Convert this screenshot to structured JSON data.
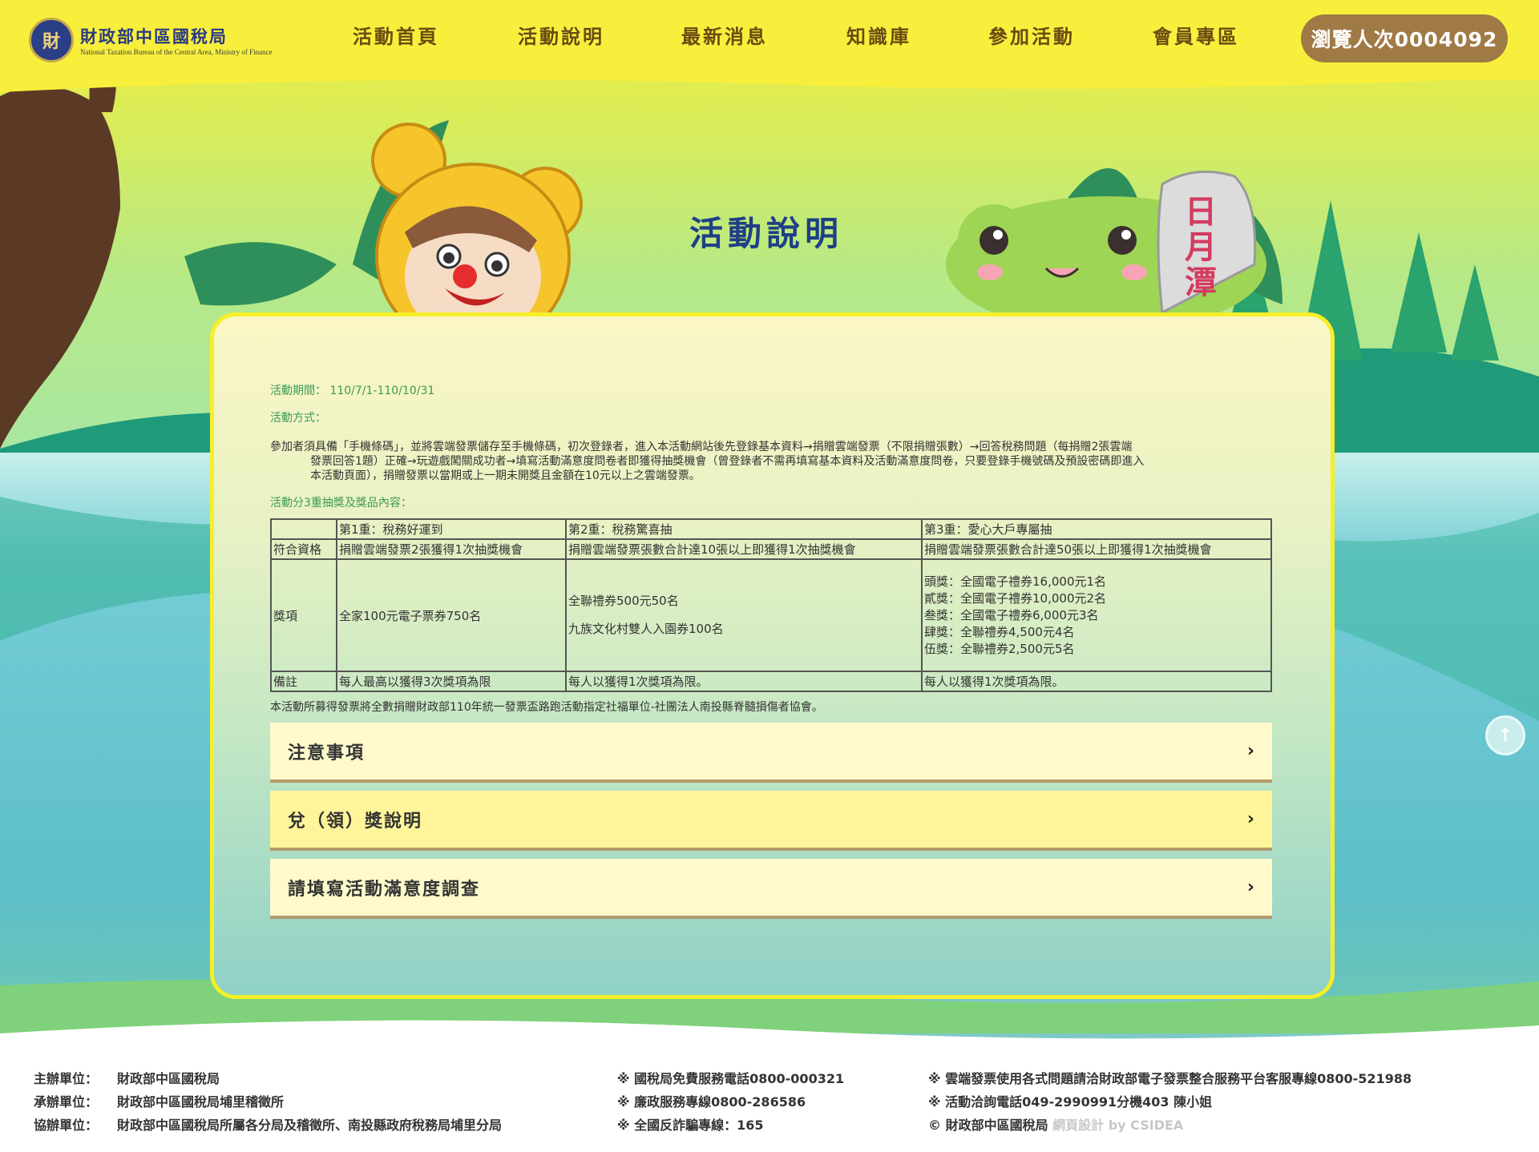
{
  "header": {
    "logo_cn": "財政部中區國稅局",
    "logo_en": "National Taxation Bureau of the Central Area, Ministry of Finance",
    "nav": [
      "活動首頁",
      "活動說明",
      "最新消息",
      "知識庫",
      "參加活動",
      "會員專區"
    ],
    "visitor_count": "瀏覽人次0004092"
  },
  "page_title": "活動說明",
  "scenery": {
    "stone_text": "日月潭"
  },
  "content": {
    "period_label": "活動期間：",
    "period_value": "110/7/1-110/10/31",
    "method_label": "活動方式：",
    "method_line1": "參加者須具備「手機條碼」，並將雲端發票儲存至手機條碼，初次登錄者，進入本活動網站後先登錄基本資料→捐贈雲端發票（不限捐贈張數）→回答稅務問題（每捐贈2張雲端",
    "method_line2": "發票回答1題）正確→玩遊戲闖關成功者→填寫活動滿意度問卷者即獲得抽獎機會（曾登錄者不需再填寫基本資料及活動滿意度問卷，只要登錄手機號碼及預設密碼即進入",
    "method_line3": "本活動頁面），捐贈發票以當期或上一期未開獎且金額在10元以上之雲端發票。",
    "prizes_label": "活動分3重抽獎及獎品內容：",
    "table": {
      "headers": [
        "",
        "第1重：稅務好運到",
        "第2重：稅務驚喜抽",
        "第3重：愛心大戶專屬抽"
      ],
      "eligibility": [
        "符合資格",
        "捐贈雲端發票2張獲得1次抽獎機會",
        "捐贈雲端發票張數合計達10張以上即獲得1次抽獎機會",
        "捐贈雲端發票張數合計達50張以上即獲得1次抽獎機會"
      ],
      "prize_label": "獎項",
      "prize1": "全家100元電子票券750名",
      "prize2": [
        "全聯禮券500元50名",
        "九族文化村雙人入園券100名"
      ],
      "prize3": [
        "頭獎：全國電子禮券16,000元1名",
        "貳獎：全國電子禮券10,000元2名",
        "叁獎：全國電子禮券6,000元3名",
        "肆獎：全聯禮券4,500元4名",
        "伍獎：全聯禮券2,500元5名"
      ],
      "remarks": [
        "備註",
        "每人最高以獲得3次獎項為限",
        "每人以獲得1次獎項為限。",
        "每人以獲得1次獎項為限。"
      ]
    },
    "donation_note": "本活動所募得發票將全數捐贈財政部110年統一發票盃路跑活動指定社福單位-社團法人南投縣脊髓損傷者協會。",
    "accordion": [
      "注意事項",
      "兌（領）獎說明",
      "請填寫活動滿意度調查"
    ]
  },
  "footer": {
    "col1": [
      {
        "label": "主辦單位：",
        "value": "財政部中區國稅局"
      },
      {
        "label": "承辦單位：",
        "value": "財政部中區國稅局埔里稽徵所"
      },
      {
        "label": "協辦單位：",
        "value": "財政部中區國稅局所屬各分局及稽徵所、南投縣政府稅務局埔里分局"
      }
    ],
    "col2": [
      "※ 國稅局免費服務電話0800-000321",
      "※ 廉政服務專線0800-286586",
      "※ 全國反詐騙專線：165"
    ],
    "col3": [
      "※ 雲端發票使用各式問題請洽財政部電子發票整合服務平台客服專線0800-521988",
      "※ 活動洽詢電話049-2990991分機403 陳小姐"
    ],
    "copyright": "© 財政部中區國稅局",
    "credit": "網頁設計 by CSIDEA"
  },
  "colors": {
    "header_bg": "#f8ef3c",
    "nav_text": "#6b4a12",
    "title": "#1f3f86",
    "badge_bg": "#a07a45",
    "label_green": "#3c9a55"
  }
}
